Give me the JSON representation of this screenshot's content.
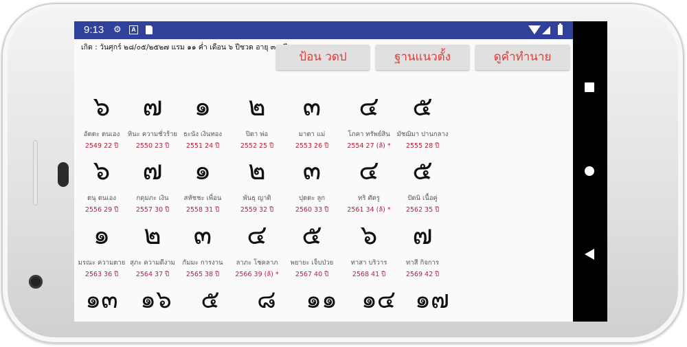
{
  "status_bar": {
    "time": "9:13",
    "icons": [
      "gear-icon",
      "a-box-icon",
      "sd-card-icon",
      "wifi-icon",
      "signal-icon",
      "battery-icon"
    ]
  },
  "header": {
    "birth_info": "เกิด : วันศุกร์ ๒๘/๐๕/๒๕๒๗ แรม ๑๑ ค่ำ เดือน ๖ ปีชวด อายุ ๓๕ ปี"
  },
  "buttons": {
    "input": "ป้อน วดป",
    "vertical": "ฐานแนวตั้ง",
    "predict": "ดูคำทำนาย"
  },
  "rows": [
    [
      {
        "digit": "๖",
        "name": "อัตตะ ตนเอง",
        "year": "2549 22 ปี"
      },
      {
        "digit": "๗",
        "name": "หินะ ความชั่วร้าย",
        "year": "2550 23 ปี"
      },
      {
        "digit": "๑",
        "name": "ธะนัง เงินทอง",
        "year": "2551 24 ปี"
      },
      {
        "digit": "๒",
        "name": "ปิตา พ่อ",
        "year": "2552 25 ปี"
      },
      {
        "digit": "๓",
        "name": "มาตา แม่",
        "year": "2553 26 ปี"
      },
      {
        "digit": "๔",
        "name": "โภคา ทรัพย์สิน",
        "year": "2554 27 (ล้) *"
      },
      {
        "digit": "๕",
        "name": "มัชฌิมา ปานกลาง",
        "year": "2555 28 ปี"
      }
    ],
    [
      {
        "digit": "๖",
        "name": "ตนุ ตนเอง",
        "year": "2556 29 ปี"
      },
      {
        "digit": "๗",
        "name": "กดุมภะ เงิน",
        "year": "2557 30 ปี"
      },
      {
        "digit": "๑",
        "name": "สหัชชะ เพื่อน",
        "year": "2558 31 ปี"
      },
      {
        "digit": "๒",
        "name": "พันธุ ญาติ",
        "year": "2559 32 ปี"
      },
      {
        "digit": "๓",
        "name": "ปุตตะ ลูก",
        "year": "2560 33 ปี"
      },
      {
        "digit": "๔",
        "name": "ทริ ศัตรู",
        "year": "2561 34 (ล้) *"
      },
      {
        "digit": "๕",
        "name": "ปัตนิ เนื้อคู่",
        "year": "2562 35 ปี"
      }
    ],
    [
      {
        "digit": "๑",
        "name": "มรณะ ความตาย",
        "year": "2563 36 ปี"
      },
      {
        "digit": "๒",
        "name": "สุภะ ความดีงาม",
        "year": "2564 37 ปี"
      },
      {
        "digit": "๓",
        "name": "กัมมะ การงาน",
        "year": "2565 38 ปี"
      },
      {
        "digit": "๔",
        "name": "ลาภะ โชคลาภ",
        "year": "2566 39 (ล้) *"
      },
      {
        "digit": "๕",
        "name": "พยายะ เจ็บป่วย",
        "year": "2567 40 ปี"
      },
      {
        "digit": "๖",
        "name": "ทาสา บริวาร",
        "year": "2568 41 ปี"
      },
      {
        "digit": "๗",
        "name": "ทาสี กิจการ",
        "year": "2569 42 ปี"
      }
    ]
  ],
  "totals": [
    "๑๓",
    "๑๖",
    "๕",
    "๘",
    "๑๑",
    "๑๔",
    "๑๗"
  ],
  "nav": {
    "icons": [
      "recents-square-icon",
      "home-circle-icon",
      "back-triangle-icon"
    ]
  }
}
